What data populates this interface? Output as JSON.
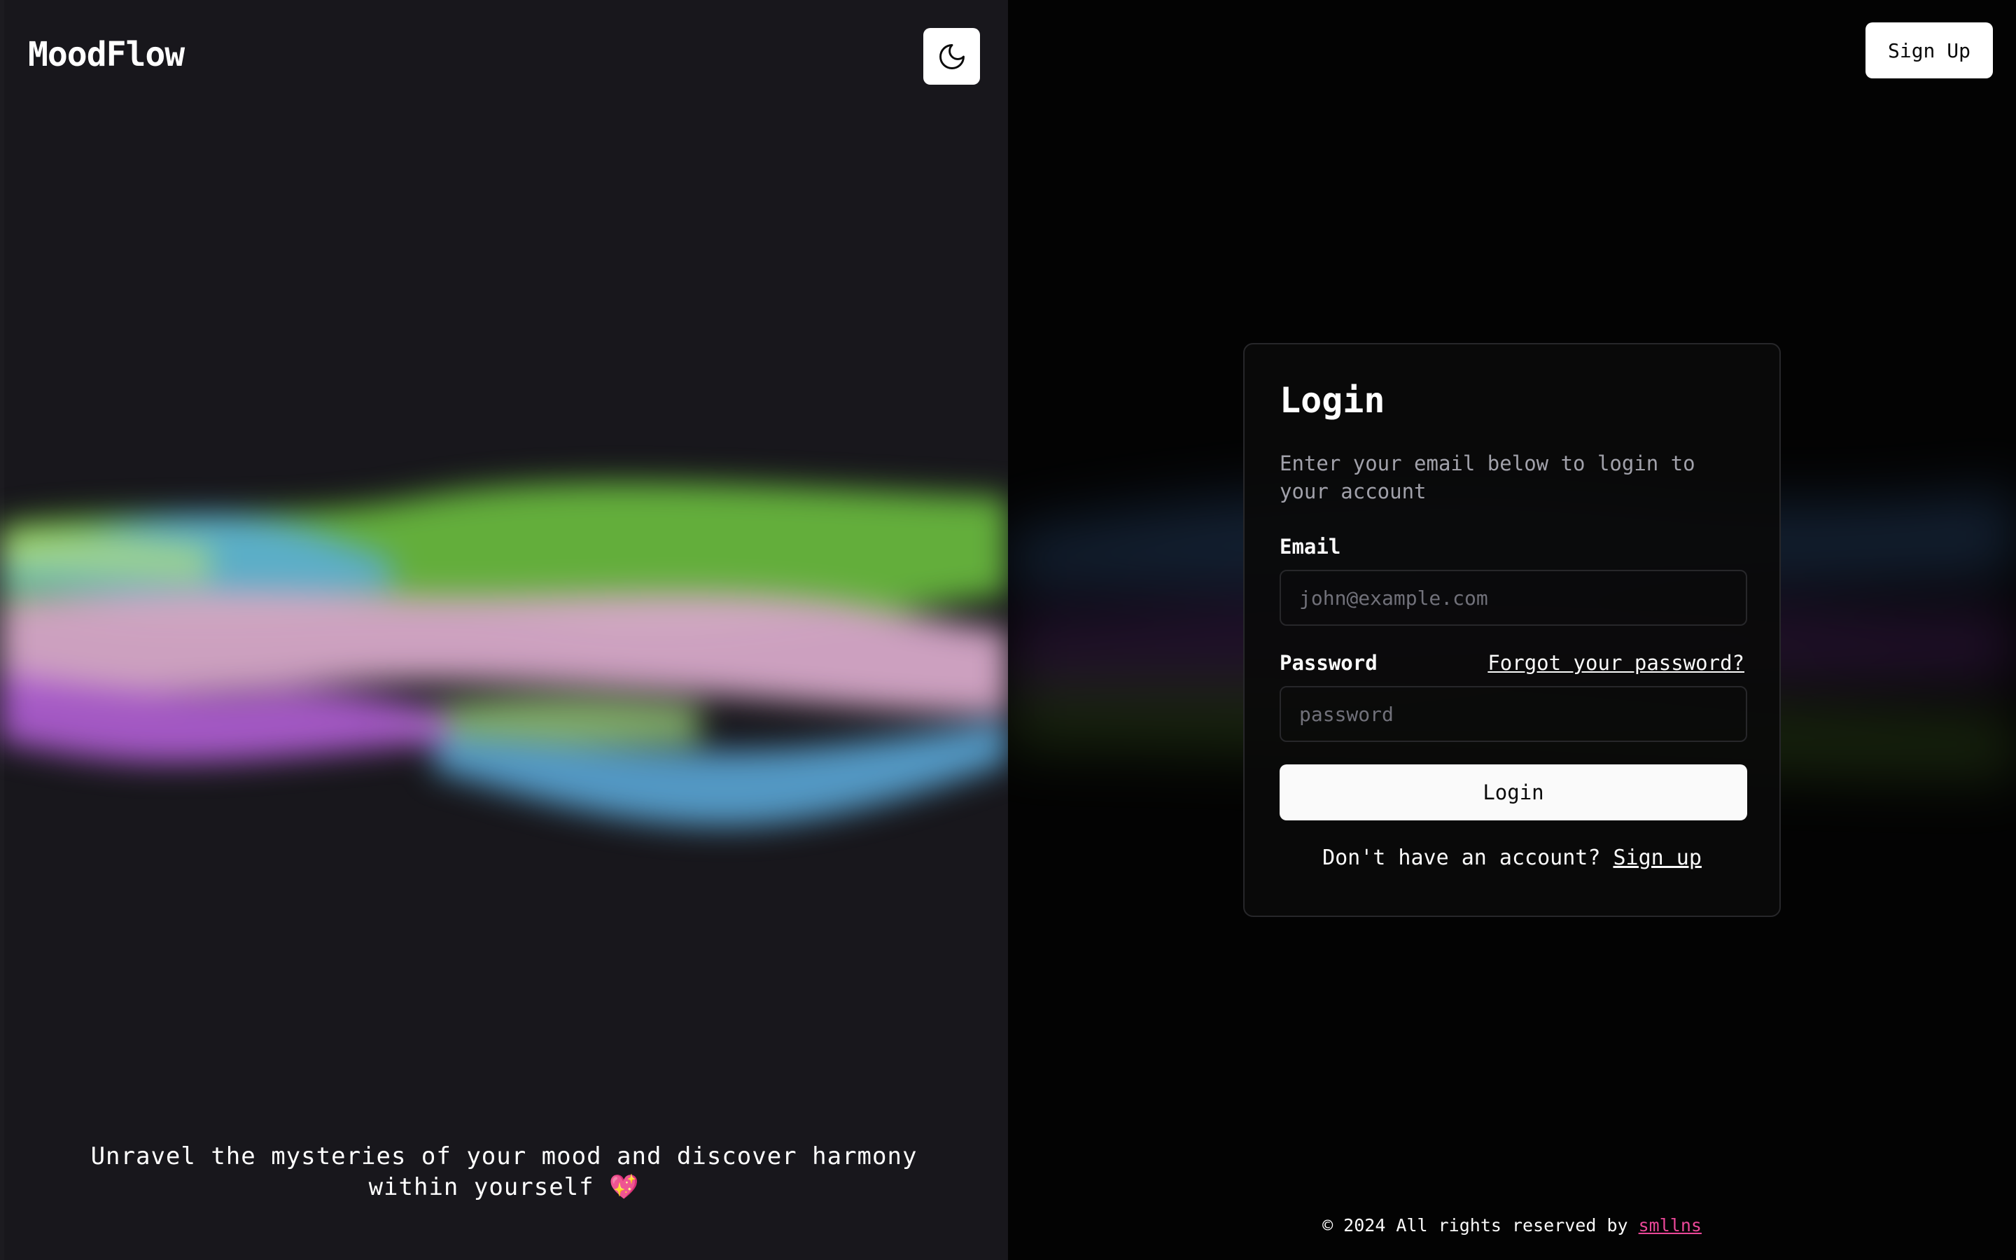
{
  "app": {
    "brand": "MoodFlow",
    "tagline": "Unravel the mysteries of your mood and discover harmony within yourself 💖"
  },
  "header": {
    "theme_toggle_icon": "moon-icon",
    "signup_button": "Sign Up"
  },
  "login_card": {
    "title": "Login",
    "description": "Enter your email below to login to your account",
    "email_label": "Email",
    "email_placeholder": "john@example.com",
    "email_value": "",
    "password_label": "Password",
    "forgot_password": "Forgot your password?",
    "password_placeholder": "password",
    "password_value": "",
    "login_button": "Login",
    "no_account_text": "Don't have an account?",
    "signup_link": "Sign up"
  },
  "footer": {
    "text": "© 2024 All rights reserved by",
    "author_link": "smllns"
  },
  "colors": {
    "left_bg": "#18171c",
    "right_bg": "#030303",
    "accent_pink": "#ec4899",
    "wave_green": "#6bbf3f",
    "wave_blue": "#5aaee0",
    "wave_pink": "#d6a0c4",
    "wave_purple": "#b25fd6"
  }
}
